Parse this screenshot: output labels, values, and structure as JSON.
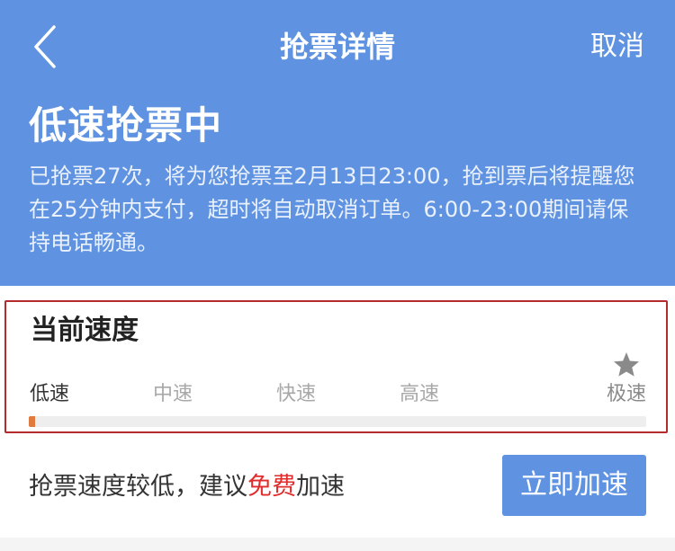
{
  "colors": {
    "header_bg": "#5f93e1",
    "accent": "#5f93e1",
    "progress_fill": "#e07a3e",
    "highlight_border": "#b52a2a",
    "free_text": "#e02c2c"
  },
  "nav": {
    "back_icon": "chevron-left-icon",
    "title": "抢票详情",
    "cancel_label": "取消"
  },
  "status": {
    "title": "低速抢票中",
    "description": "已抢票27次，将为您抢票至2月13日23:00，抢到票后将提醒您在25分钟内支付，超时将自动取消订单。6:00-23:00期间请保持电话畅通。"
  },
  "speed": {
    "heading": "当前速度",
    "top_level_icon": "star-icon",
    "levels": [
      "低速",
      "中速",
      "快速",
      "高速",
      "极速"
    ],
    "current_level_index": 0,
    "progress_fraction": 0.01
  },
  "suggest": {
    "text_prefix": "抢票速度较低，建议",
    "text_highlight": "免费",
    "text_suffix": "加速",
    "button_label": "立即加速"
  }
}
